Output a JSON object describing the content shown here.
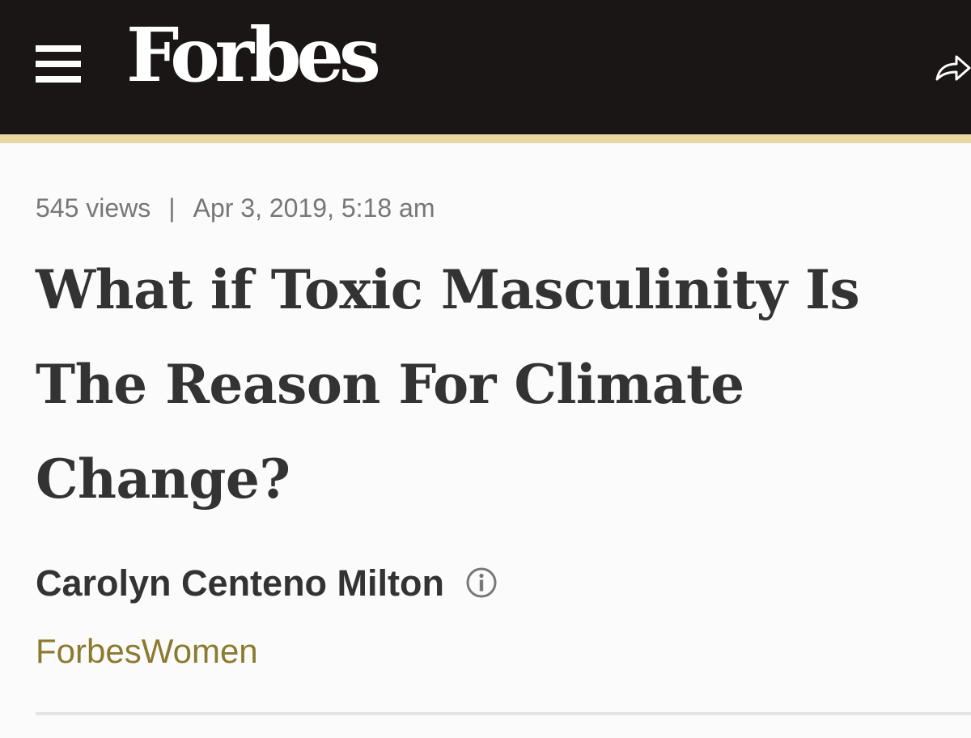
{
  "header": {
    "logo_text": "Forbes",
    "menu_icon": "hamburger-menu-icon",
    "share_icon": "share-arrow-icon",
    "background_color": "#1a1615",
    "accent_rule_color": "#e8d7a3"
  },
  "article": {
    "views": "545 views",
    "separator": "|",
    "timestamp": "Apr 3, 2019, 5:18 am",
    "headline": "What if Toxic Masculinity Is The Reason For Climate Change?",
    "author": "Carolyn Centeno Milton",
    "author_info_icon": "info-circle-icon",
    "channel": "ForbesWomen",
    "channel_color": "#8c7a2f"
  }
}
